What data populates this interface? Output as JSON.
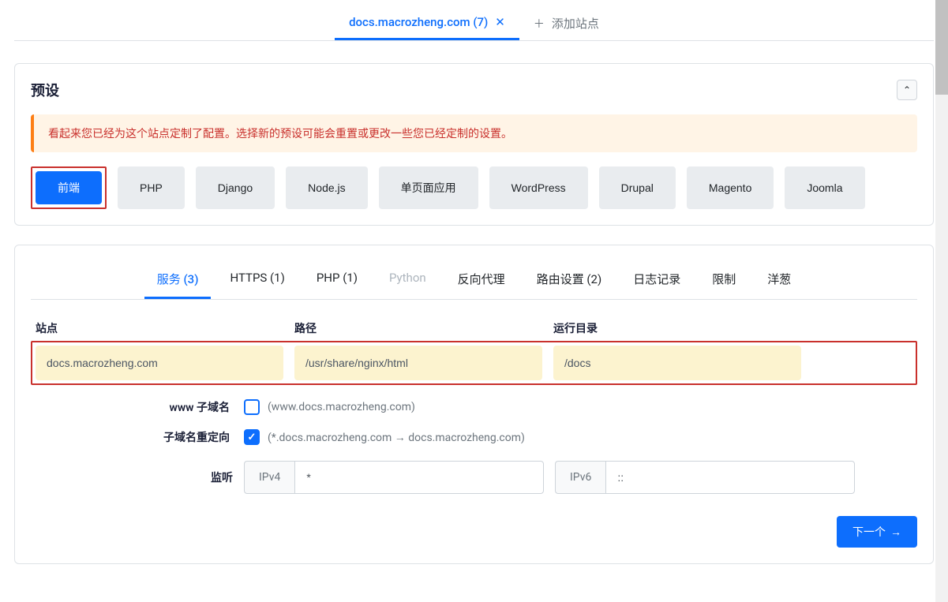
{
  "top_tabs": {
    "active": "docs.macrozheng.com (7)",
    "add_site": "添加站点"
  },
  "presets": {
    "title": "预设",
    "warning": "看起来您已经为这个站点定制了配置。选择新的预设可能会重置或更改一些您已经定制的设置。",
    "options": [
      "前端",
      "PHP",
      "Django",
      "Node.js",
      "单页面应用",
      "WordPress",
      "Drupal",
      "Magento",
      "Joomla"
    ]
  },
  "inner_tabs": [
    {
      "label": "服务 (3)",
      "state": "active"
    },
    {
      "label": "HTTPS (1)",
      "state": "normal"
    },
    {
      "label": "PHP (1)",
      "state": "normal"
    },
    {
      "label": "Python",
      "state": "disabled"
    },
    {
      "label": "反向代理",
      "state": "normal"
    },
    {
      "label": "路由设置 (2)",
      "state": "normal"
    },
    {
      "label": "日志记录",
      "state": "normal"
    },
    {
      "label": "限制",
      "state": "normal"
    },
    {
      "label": "洋葱",
      "state": "normal"
    }
  ],
  "fields": {
    "site_label": "站点",
    "site_value": "docs.macrozheng.com",
    "path_label": "路径",
    "path_value": "/usr/share/nginx/html",
    "root_label": "运行目录",
    "root_value": "/docs"
  },
  "www_subdomain": {
    "label": "www 子域名",
    "hint": "(www.docs.macrozheng.com)"
  },
  "subdomain_redirect": {
    "label": "子域名重定向",
    "hint": "(*.docs.macrozheng.com → docs.macrozheng.com)"
  },
  "listen": {
    "label": "监听",
    "ipv4_prefix": "IPv4",
    "ipv4_value": "*",
    "ipv6_prefix": "IPv6",
    "ipv6_value": "::"
  },
  "next_button": "下一个"
}
